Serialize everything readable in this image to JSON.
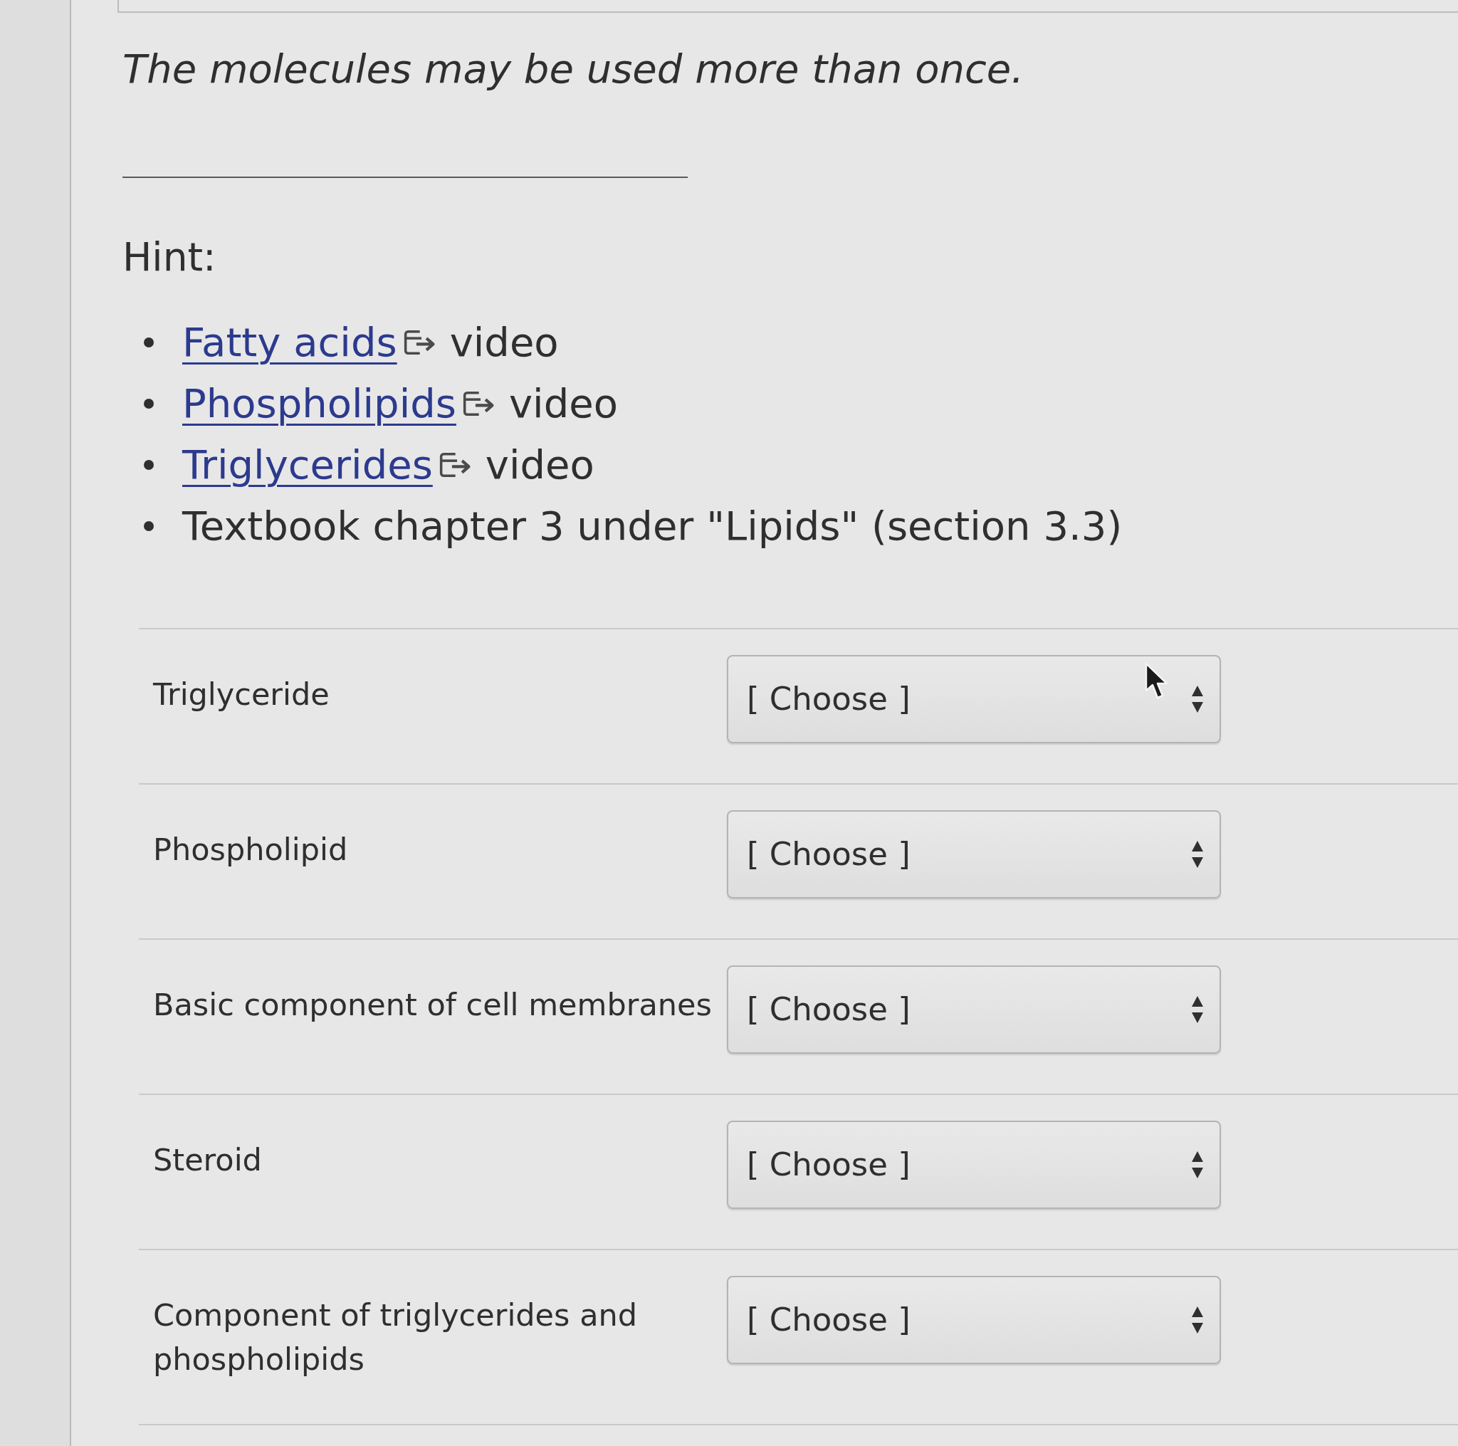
{
  "instructions": "The molecules may be used more than once.",
  "hint": {
    "label": "Hint:",
    "items": [
      {
        "kind": "link",
        "link_text": "Fatty acids",
        "suffix": "video"
      },
      {
        "kind": "link",
        "link_text": "Phospholipids",
        "suffix": "video"
      },
      {
        "kind": "link",
        "link_text": "Triglycerides",
        "suffix": "video"
      },
      {
        "kind": "text",
        "text": "Textbook chapter 3 under \"Lipids\" (section 3.3)"
      }
    ]
  },
  "matches": [
    {
      "label": "Triglyceride",
      "select": {
        "value": "[ Choose ]"
      }
    },
    {
      "label": "Phospholipid",
      "select": {
        "value": "[ Choose ]"
      }
    },
    {
      "label": "Basic component of cell membranes",
      "select": {
        "value": "[ Choose ]"
      }
    },
    {
      "label": "Steroid",
      "select": {
        "value": "[ Choose ]"
      }
    },
    {
      "label": "Component of triglycerides and phospholipids",
      "select": {
        "value": "[ Choose ]"
      }
    }
  ]
}
